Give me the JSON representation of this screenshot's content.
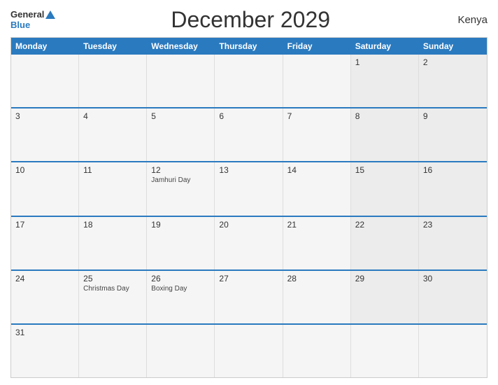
{
  "header": {
    "logo_general": "General",
    "logo_blue": "Blue",
    "title": "December 2029",
    "country": "Kenya"
  },
  "days_of_week": [
    "Monday",
    "Tuesday",
    "Wednesday",
    "Thursday",
    "Friday",
    "Saturday",
    "Sunday"
  ],
  "weeks": [
    [
      {
        "num": "",
        "holiday": "",
        "type": "empty"
      },
      {
        "num": "",
        "holiday": "",
        "type": "empty"
      },
      {
        "num": "",
        "holiday": "",
        "type": "empty"
      },
      {
        "num": "",
        "holiday": "",
        "type": "empty"
      },
      {
        "num": "",
        "holiday": "",
        "type": "empty"
      },
      {
        "num": "1",
        "holiday": "",
        "type": "saturday"
      },
      {
        "num": "2",
        "holiday": "",
        "type": "sunday"
      }
    ],
    [
      {
        "num": "3",
        "holiday": "",
        "type": "weekday"
      },
      {
        "num": "4",
        "holiday": "",
        "type": "weekday"
      },
      {
        "num": "5",
        "holiday": "",
        "type": "weekday"
      },
      {
        "num": "6",
        "holiday": "",
        "type": "weekday"
      },
      {
        "num": "7",
        "holiday": "",
        "type": "weekday"
      },
      {
        "num": "8",
        "holiday": "",
        "type": "saturday"
      },
      {
        "num": "9",
        "holiday": "",
        "type": "sunday"
      }
    ],
    [
      {
        "num": "10",
        "holiday": "",
        "type": "weekday"
      },
      {
        "num": "11",
        "holiday": "",
        "type": "weekday"
      },
      {
        "num": "12",
        "holiday": "Jamhuri Day",
        "type": "weekday"
      },
      {
        "num": "13",
        "holiday": "",
        "type": "weekday"
      },
      {
        "num": "14",
        "holiday": "",
        "type": "weekday"
      },
      {
        "num": "15",
        "holiday": "",
        "type": "saturday"
      },
      {
        "num": "16",
        "holiday": "",
        "type": "sunday"
      }
    ],
    [
      {
        "num": "17",
        "holiday": "",
        "type": "weekday"
      },
      {
        "num": "18",
        "holiday": "",
        "type": "weekday"
      },
      {
        "num": "19",
        "holiday": "",
        "type": "weekday"
      },
      {
        "num": "20",
        "holiday": "",
        "type": "weekday"
      },
      {
        "num": "21",
        "holiday": "",
        "type": "weekday"
      },
      {
        "num": "22",
        "holiday": "",
        "type": "saturday"
      },
      {
        "num": "23",
        "holiday": "",
        "type": "sunday"
      }
    ],
    [
      {
        "num": "24",
        "holiday": "",
        "type": "weekday"
      },
      {
        "num": "25",
        "holiday": "Christmas Day",
        "type": "weekday"
      },
      {
        "num": "26",
        "holiday": "Boxing Day",
        "type": "weekday"
      },
      {
        "num": "27",
        "holiday": "",
        "type": "weekday"
      },
      {
        "num": "28",
        "holiday": "",
        "type": "weekday"
      },
      {
        "num": "29",
        "holiday": "",
        "type": "saturday"
      },
      {
        "num": "30",
        "holiday": "",
        "type": "sunday"
      }
    ],
    [
      {
        "num": "31",
        "holiday": "",
        "type": "weekday"
      },
      {
        "num": "",
        "holiday": "",
        "type": "empty"
      },
      {
        "num": "",
        "holiday": "",
        "type": "empty"
      },
      {
        "num": "",
        "holiday": "",
        "type": "empty"
      },
      {
        "num": "",
        "holiday": "",
        "type": "empty"
      },
      {
        "num": "",
        "holiday": "",
        "type": "empty"
      },
      {
        "num": "",
        "holiday": "",
        "type": "empty"
      }
    ]
  ]
}
